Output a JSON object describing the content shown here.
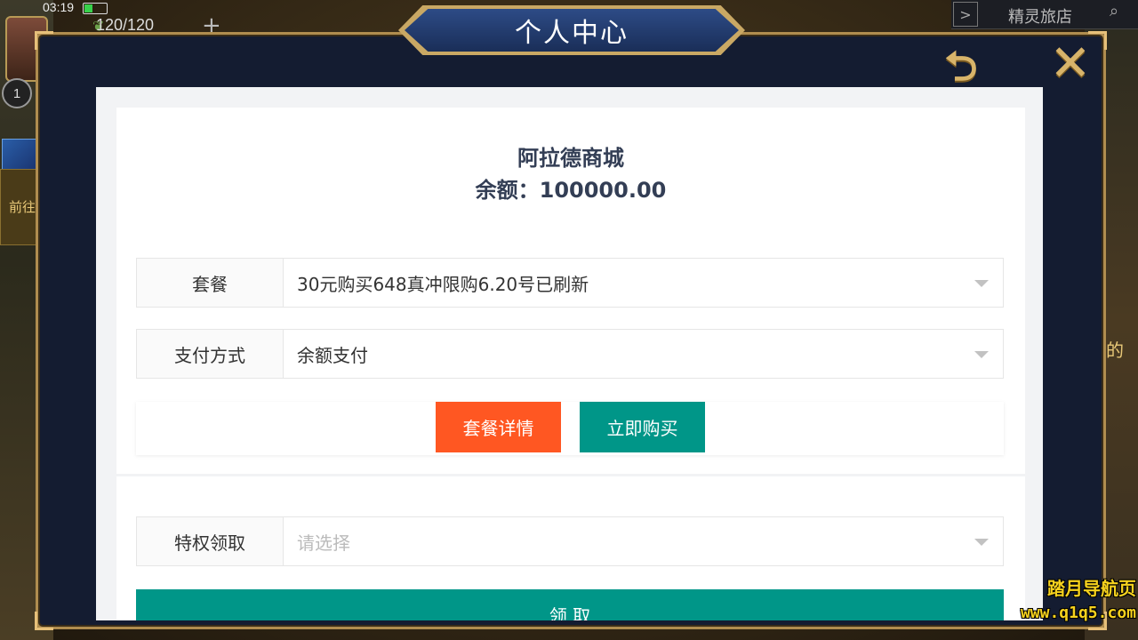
{
  "status_bar": {
    "time": "03:19"
  },
  "hud": {
    "hp": "120/120",
    "level": "1",
    "side_label": "前往",
    "top_right_title": "精灵旅店",
    "right_edge_text": "的"
  },
  "modal": {
    "title": "个人中心"
  },
  "shop": {
    "name": "阿拉德商城",
    "balance": "余额：100000.00",
    "package": {
      "label": "套餐",
      "value": "30元购买648真冲限购6.20号已刷新"
    },
    "payment": {
      "label": "支付方式",
      "value": "余额支付"
    },
    "buttons": {
      "detail": "套餐详情",
      "buy": "立即购买"
    },
    "privilege": {
      "label": "特权领取",
      "placeholder": "请选择"
    },
    "claim_button": "领 取"
  },
  "watermark": {
    "line1": "踏月导航页",
    "line2": "www.q1q5.com"
  },
  "colors": {
    "detail_button": "#ff5722",
    "buy_button": "#009688",
    "modal_border": "#b08d4f"
  }
}
